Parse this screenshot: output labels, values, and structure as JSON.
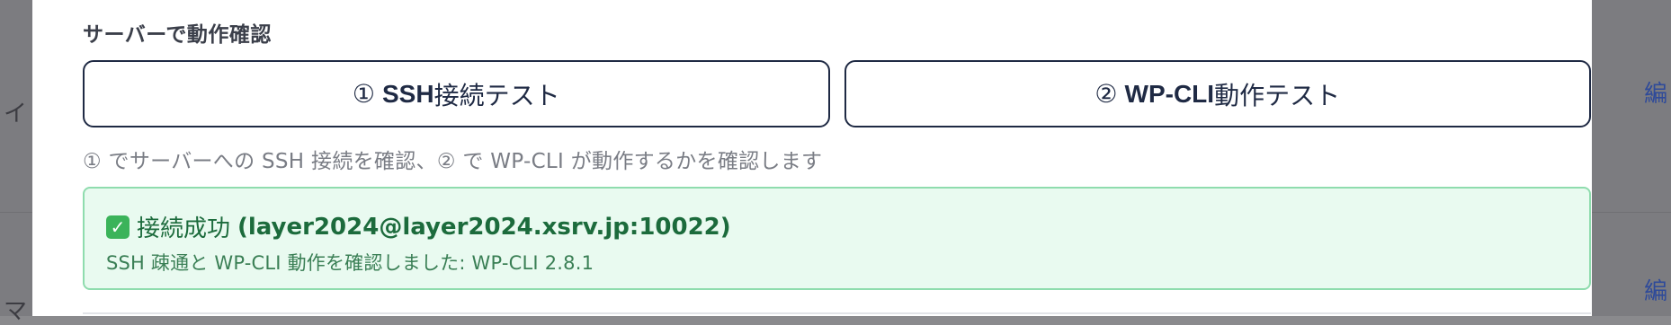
{
  "backdrop": {
    "left_chars": [
      "イ",
      "マ"
    ],
    "right_links": [
      "編",
      "編"
    ]
  },
  "section": {
    "title": "サーバーで動作確認"
  },
  "buttons": [
    {
      "num": "①",
      "strong": "SSH",
      "rest": "接続テスト"
    },
    {
      "num": "②",
      "strong": "WP-CLI",
      "rest": "動作テスト"
    }
  ],
  "hint": "① でサーバーへの SSH 接続を確認、② で WP-CLI が動作するかを確認します",
  "result": {
    "status_icon": "check-mark-icon",
    "status_label": "接続成功",
    "host": "(layer2024@layer2024.xsrv.jp:10022)",
    "detail": "SSH 疎通と WP-CLI 動作を確認しました: WP-CLI 2.8.1",
    "colors": {
      "border": "#8fdcae",
      "background": "#e9faf0",
      "text": "#1c6b3c"
    }
  }
}
